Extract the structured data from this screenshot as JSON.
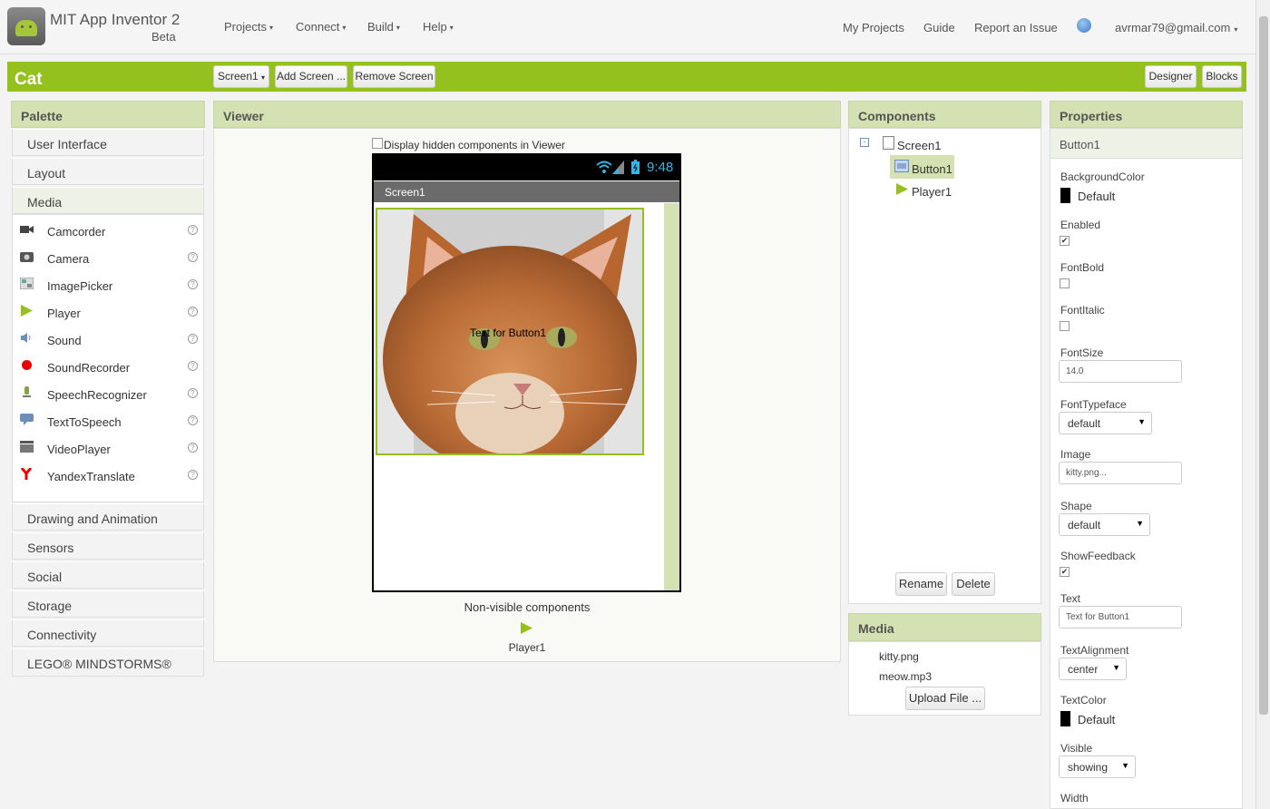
{
  "app": {
    "title": "MIT App Inventor 2",
    "beta": "Beta"
  },
  "topnav": {
    "left": [
      "Projects",
      "Connect",
      "Build",
      "Help"
    ],
    "right": [
      "My Projects",
      "Guide",
      "Report an Issue"
    ],
    "account": "avrmar79@gmail.com"
  },
  "project": {
    "name": "Cat",
    "screen_select": "Screen1",
    "add_screen": "Add Screen ...",
    "remove_screen": "Remove Screen",
    "designer": "Designer",
    "blocks": "Blocks"
  },
  "palette": {
    "title": "Palette",
    "categories_top": [
      "User Interface",
      "Layout",
      "Media"
    ],
    "media_items": [
      {
        "label": "Camcorder",
        "icon": "camcorder-icon"
      },
      {
        "label": "Camera",
        "icon": "camera-icon"
      },
      {
        "label": "ImagePicker",
        "icon": "imagepicker-icon"
      },
      {
        "label": "Player",
        "icon": "player-icon"
      },
      {
        "label": "Sound",
        "icon": "sound-icon"
      },
      {
        "label": "SoundRecorder",
        "icon": "soundrecorder-icon"
      },
      {
        "label": "SpeechRecognizer",
        "icon": "speechrecognizer-icon"
      },
      {
        "label": "TextToSpeech",
        "icon": "texttospeech-icon"
      },
      {
        "label": "VideoPlayer",
        "icon": "videoplayer-icon"
      },
      {
        "label": "YandexTranslate",
        "icon": "yandextranslate-icon"
      }
    ],
    "categories_bottom": [
      "Drawing and Animation",
      "Sensors",
      "Social",
      "Storage",
      "Connectivity",
      "LEGO® MINDSTORMS®"
    ]
  },
  "viewer": {
    "title": "Viewer",
    "hidden_checkbox_label": "Display hidden components in Viewer",
    "clock": "9:48",
    "screen_title": "Screen1",
    "button_text": "Text for Button1",
    "nonvisible_title": "Non-visible components",
    "nonvisible_item": "Player1"
  },
  "components": {
    "title": "Components",
    "tree": [
      "Screen1",
      "Button1",
      "Player1"
    ],
    "rename": "Rename",
    "delete": "Delete"
  },
  "media": {
    "title": "Media",
    "files": [
      "kitty.png",
      "meow.mp3"
    ],
    "upload": "Upload File ..."
  },
  "properties": {
    "title": "Properties",
    "component": "Button1",
    "background_color_label": "BackgroundColor",
    "background_color_value": "Default",
    "enabled_label": "Enabled",
    "fontbold_label": "FontBold",
    "fontitalic_label": "FontItalic",
    "fontsize_label": "FontSize",
    "fontsize_value": "14.0",
    "fonttypeface_label": "FontTypeface",
    "fonttypeface_value": "default",
    "image_label": "Image",
    "image_value": "kitty.png...",
    "shape_label": "Shape",
    "shape_value": "default",
    "showfeedback_label": "ShowFeedback",
    "text_label": "Text",
    "text_value": "Text for Button1",
    "textalignment_label": "TextAlignment",
    "textalignment_value": "center",
    "textcolor_label": "TextColor",
    "textcolor_value": "Default",
    "visible_label": "Visible",
    "visible_value": "showing",
    "width_label": "Width"
  },
  "colors": {
    "accent": "#95c11f",
    "panel_header": "#d4e2b3"
  }
}
